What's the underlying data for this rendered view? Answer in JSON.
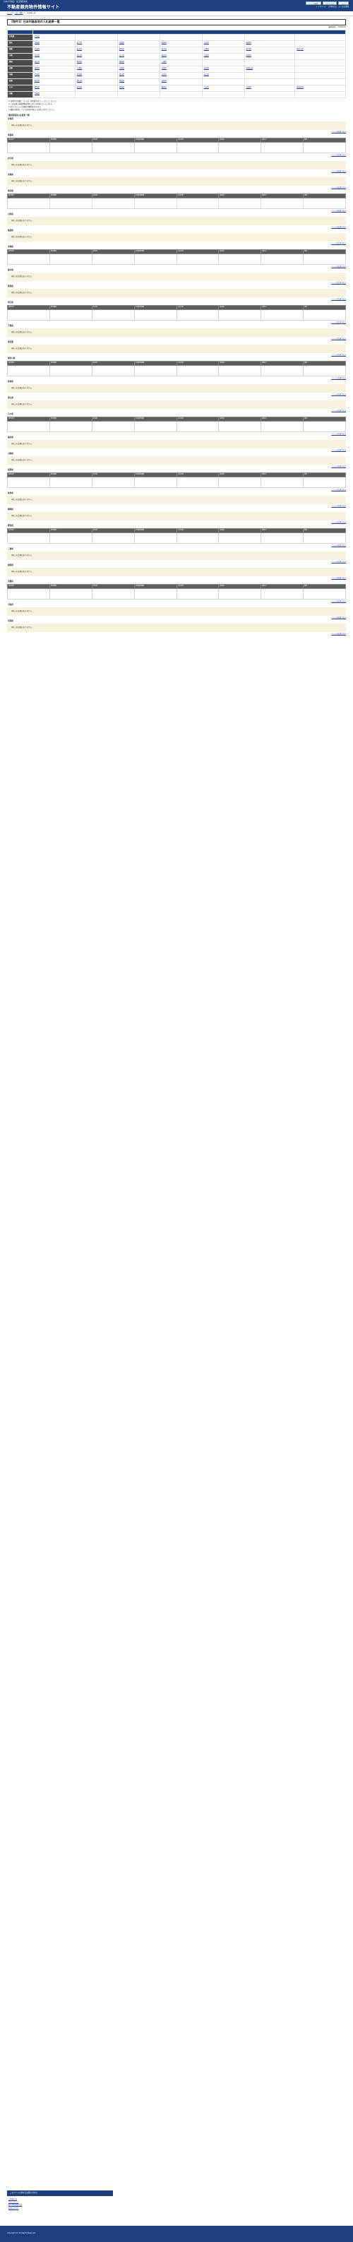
{
  "header": {
    "tagline": "日本の不動産・競売物件情報",
    "site_title": "不動産競売物件情報サイト",
    "buttons": [
      "サイト内検索",
      "文字サイズ",
      "ヘルプ"
    ],
    "subnav": [
      "トップページ",
      "ご利用方法",
      "よくある質問"
    ]
  },
  "breadcrumb": [
    "トップ",
    "入札・開札",
    "入札結果一覧"
  ],
  "page": {
    "title": "【物件1】日本列島各地の入札結果一覧",
    "updated": "最終更新日：2020年3月"
  },
  "regions": [
    {
      "region": "北海道",
      "prefs": [
        "北海道"
      ]
    },
    {
      "region": "東北",
      "prefs": [
        "青森県",
        "岩手県",
        "宮城県",
        "秋田県",
        "山形県",
        "福島県"
      ]
    },
    {
      "region": "関東",
      "prefs": [
        "茨城県",
        "栃木県",
        "群馬県",
        "埼玉県",
        "千葉県",
        "東京都",
        "神奈川県"
      ]
    },
    {
      "region": "中部",
      "prefs": [
        "新潟県",
        "富山県",
        "石川県",
        "福井県",
        "山梨県",
        "長野県"
      ]
    },
    {
      "region": "東海",
      "prefs": [
        "岐阜県",
        "静岡県",
        "愛知県",
        "三重県"
      ]
    },
    {
      "region": "近畿",
      "prefs": [
        "滋賀県",
        "京都府",
        "大阪府",
        "兵庫県",
        "奈良県",
        "和歌山県"
      ]
    },
    {
      "region": "中国",
      "prefs": [
        "鳥取県",
        "島根県",
        "岡山県",
        "広島県",
        "山口県"
      ]
    },
    {
      "region": "四国",
      "prefs": [
        "徳島県",
        "香川県",
        "愛媛県",
        "高知県"
      ]
    },
    {
      "region": "九州",
      "prefs": [
        "福岡県",
        "佐賀県",
        "長崎県",
        "熊本県",
        "大分県",
        "宮崎県",
        "鹿児島県"
      ]
    },
    {
      "region": "沖縄",
      "prefs": [
        "沖縄県"
      ]
    }
  ],
  "notes": [
    "※ 各物件の詳細については、物件番号をクリックしてください。",
    "※ 入札結果の掲載期間は開札日から1年間となっています。",
    "※ 表示されている金額は消費税を含みます。",
    "※ 最新の情報については各担当窓口へお問い合わせください。"
  ],
  "section_title": "【都道府県別入札結果一覧】",
  "table_headers": [
    "事件番号",
    "物件種別",
    "所在地",
    "売却基準価額",
    "入札件数",
    "最高価",
    "開札日",
    "備考"
  ],
  "empty_text": "現在入札結果はありません。",
  "to_top": "ページの先頭へ戻る",
  "prefectures": [
    "北海道",
    "青森県",
    "岩手県",
    "宮城県",
    "秋田県",
    "山形県",
    "福島県",
    "茨城県",
    "栃木県",
    "群馬県",
    "埼玉県",
    "千葉県",
    "東京都",
    "神奈川県",
    "新潟県",
    "富山県",
    "石川県",
    "福井県",
    "山梨県",
    "長野県",
    "岐阜県",
    "静岡県",
    "愛知県",
    "三重県",
    "滋賀県",
    "京都府",
    "大阪府",
    "兵庫県"
  ],
  "footer": {
    "banner": "このページに関するお問い合わせ",
    "links": [
      "ご利用方法",
      "サイトマップ",
      "個人情報保護方針",
      "お問い合わせ"
    ],
    "copyright": "Copyright (C) All Rights Reserved."
  },
  "colors": {
    "primary": "#1d3f7e",
    "notice_bg": "#f7f2dd",
    "header_gray": "#5d5d5d"
  }
}
